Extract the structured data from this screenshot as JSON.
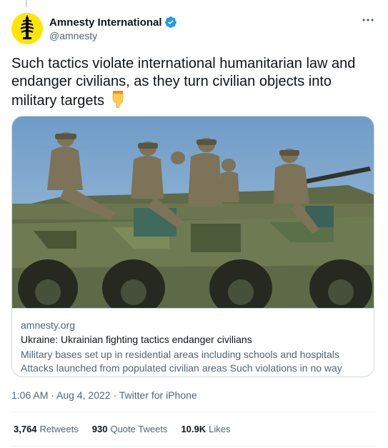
{
  "author": {
    "display_name": "Amnesty International",
    "handle": "@amnesty",
    "verified_icon": "verified-badge-icon",
    "avatar_icon": "amnesty-candle-logo",
    "avatar_color": "#ffe600"
  },
  "tweet": {
    "text": "Such tactics violate international humanitarian law and endanger civilians, as they turn civilian objects into military targets",
    "emoji": "backhand-index-pointing-down-icon"
  },
  "card": {
    "image_icon": "soldiers-on-armored-vehicle-photo",
    "domain": "amnesty.org",
    "title": "Ukraine: Ukrainian fighting tactics endanger civilians",
    "description": "Military bases set up in residential areas including schools and hospitals  Attacks launched from populated civilian areas Such violations in no way justify Russia'…"
  },
  "meta": {
    "time": "1:06 AM",
    "separator": " · ",
    "date": "Aug 4, 2022",
    "source": "Twitter for iPhone"
  },
  "stats": {
    "retweets_count": "3,764",
    "retweets_label": "Retweets",
    "quotes_count": "930",
    "quotes_label": "Quote Tweets",
    "likes_count": "10.9K",
    "likes_label": "Likes"
  },
  "colors": {
    "text": "#0f1419",
    "secondary": "#536471",
    "border": "#cfd9de",
    "verified": "#1d9bf0"
  }
}
